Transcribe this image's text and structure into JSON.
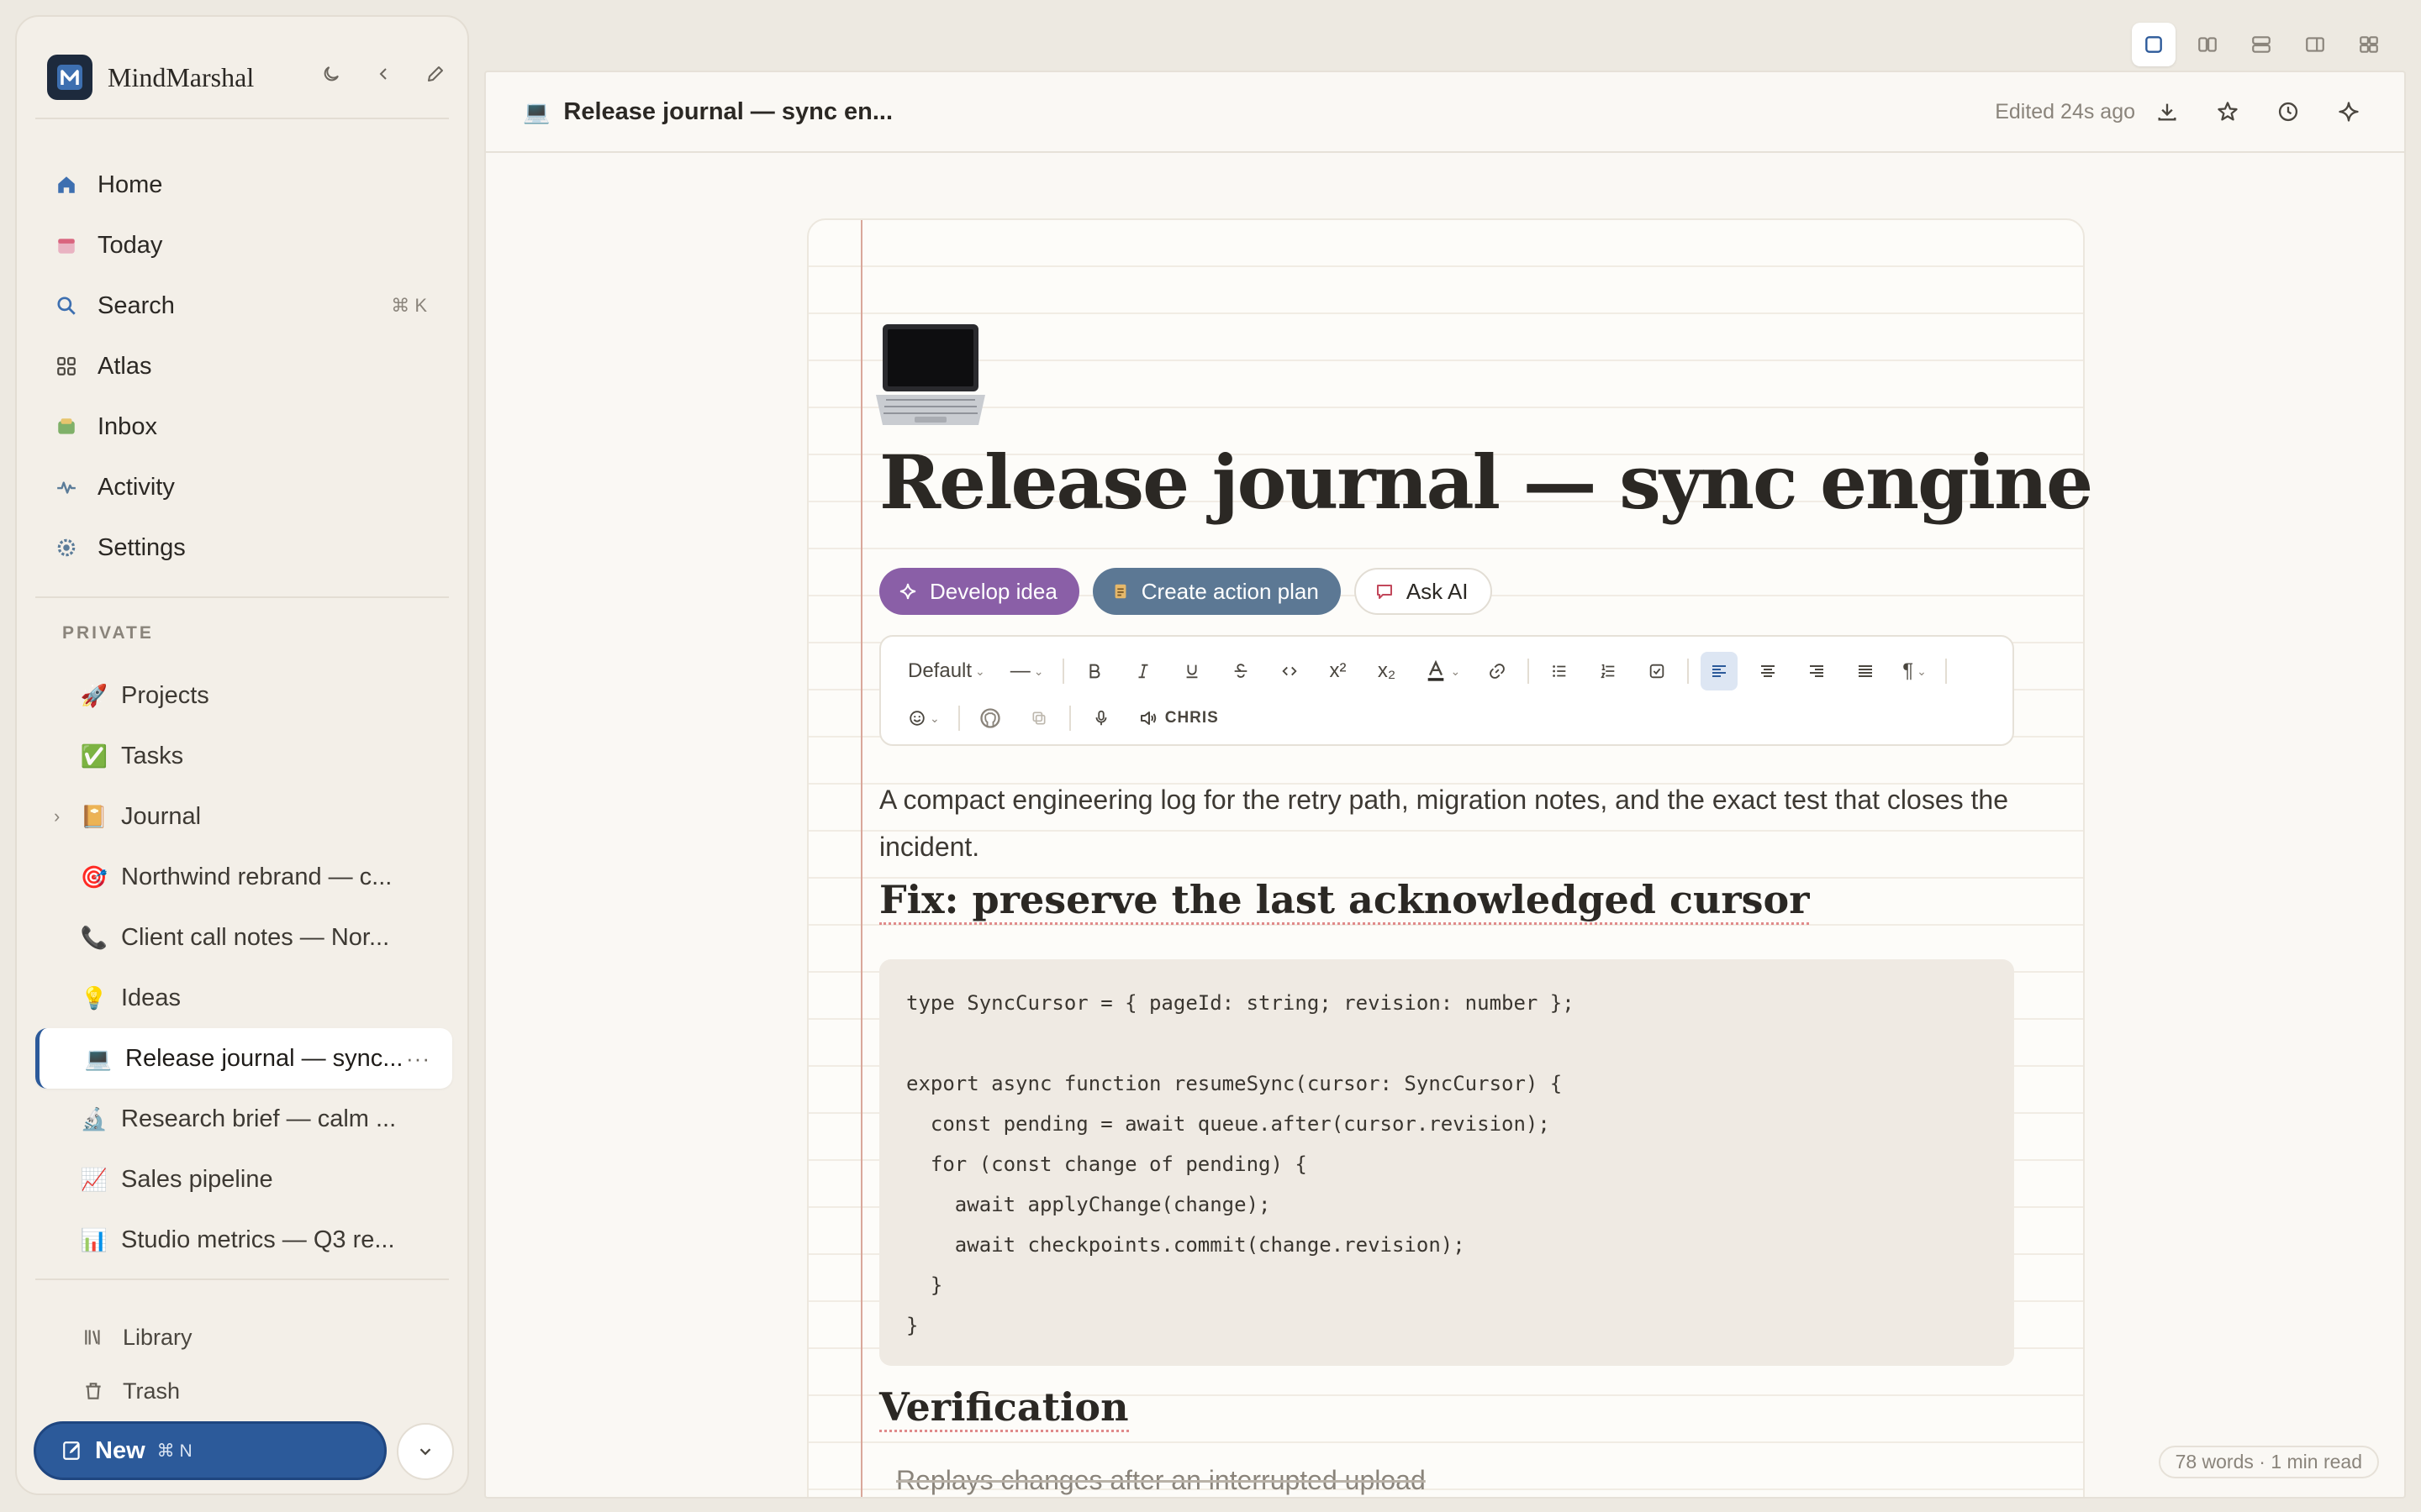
{
  "app": {
    "name": "MindMarshal",
    "accent": "#2c5a9a"
  },
  "nav": [
    {
      "label": "Home",
      "icon": "home-icon"
    },
    {
      "label": "Today",
      "icon": "calendar-icon"
    },
    {
      "label": "Search",
      "icon": "search-icon",
      "shortcut": "⌘ K"
    },
    {
      "label": "Atlas",
      "icon": "grid-icon"
    },
    {
      "label": "Inbox",
      "icon": "inbox-icon"
    },
    {
      "label": "Activity",
      "icon": "activity-icon"
    },
    {
      "label": "Settings",
      "icon": "gear-icon"
    }
  ],
  "private_label": "PRIVATE",
  "pages": [
    {
      "emoji": "🚀",
      "label": "Projects"
    },
    {
      "emoji": "✅",
      "label": "Tasks"
    },
    {
      "emoji": "📔",
      "label": "Journal"
    },
    {
      "emoji": "🎯",
      "label": "Northwind rebrand — c..."
    },
    {
      "emoji": "📞",
      "label": "Client call notes — Nor..."
    },
    {
      "emoji": "💡",
      "label": "Ideas"
    },
    {
      "emoji": "💻",
      "label": "Release journal — sync..."
    },
    {
      "emoji": "🔬",
      "label": "Research brief — calm ..."
    },
    {
      "emoji": "📈",
      "label": "Sales pipeline"
    },
    {
      "emoji": "📊",
      "label": "Studio metrics — Q3 re..."
    }
  ],
  "bottom_links": [
    {
      "label": "Library",
      "icon": "library-icon"
    },
    {
      "label": "Trash",
      "icon": "trash-icon"
    }
  ],
  "new_button": {
    "label": "New",
    "shortcut": "⌘ N"
  },
  "header": {
    "emoji": "💻",
    "title": "Release journal — sync en...",
    "edited": "Edited 24s ago"
  },
  "doc": {
    "title": "Release journal — sync engine",
    "chips": {
      "develop": "Develop idea",
      "plan": "Create action plan",
      "ask": "Ask AI"
    },
    "toolbar": {
      "style": "Default",
      "divider": "—",
      "voice": "CHRIS"
    },
    "intro": "A compact engineering log for the retry path, migration notes, and the exact test that closes the incident.",
    "h_fix": "Fix: preserve the last acknowledged cursor",
    "code": "type SyncCursor = { pageId: string; revision: number };\n\nexport async function resumeSync(cursor: SyncCursor) {\n  const pending = await queue.after(cursor.revision);\n  for (const change of pending) {\n    await applyChange(change);\n    await checkpoints.commit(change.revision);\n  }\n}",
    "h_verif": "Verification",
    "verif_item": "Replays changes after an interrupted upload",
    "word_count": "78 words · 1 min read"
  }
}
